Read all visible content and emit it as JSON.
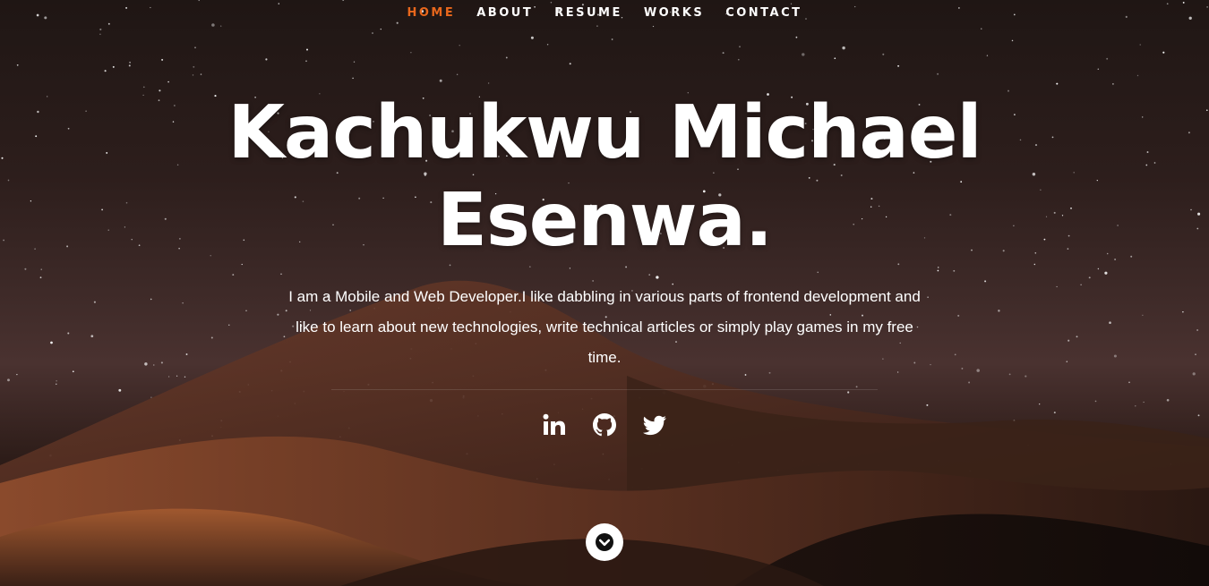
{
  "nav": {
    "items": [
      {
        "label": "HOME",
        "active": true
      },
      {
        "label": "ABOUT",
        "active": false
      },
      {
        "label": "RESUME",
        "active": false
      },
      {
        "label": "WORKS",
        "active": false
      },
      {
        "label": "CONTACT",
        "active": false
      }
    ],
    "active_color": "#e8671c"
  },
  "hero": {
    "name_line1": "Kachukwu Michael",
    "name_line2": "Esenwa.",
    "intro": "I am a Mobile and Web Developer.I like dabbling in various parts of frontend development and like to learn about new technologies, write technical articles or simply play games in my free time."
  },
  "social": [
    {
      "icon": "linkedin-icon"
    },
    {
      "icon": "github-icon"
    },
    {
      "icon": "twitter-icon"
    }
  ],
  "scroll": {
    "icon": "chevron-down-icon"
  }
}
